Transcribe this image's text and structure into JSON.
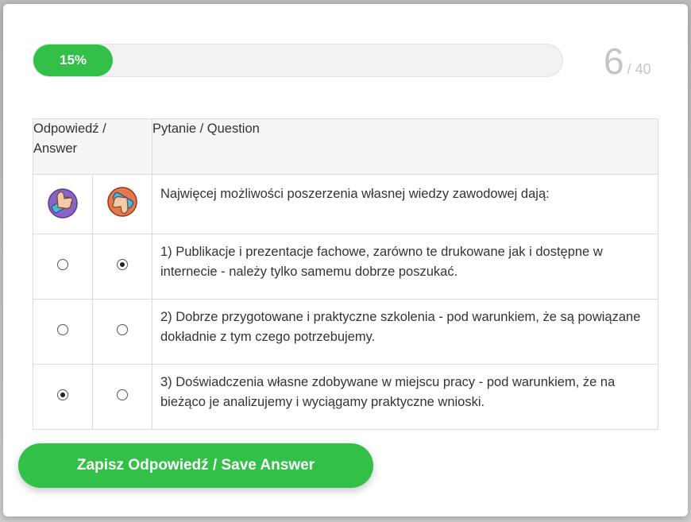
{
  "progress": {
    "percent": 15,
    "label": "15%"
  },
  "counter": {
    "current": "6",
    "total": "/ 40"
  },
  "table": {
    "header_answer": "Odpowiedź / Answer",
    "header_question": "Pytanie / Question",
    "icons": [
      "thumbs-up-icon",
      "thumbs-down-icon"
    ],
    "question": "Najwięcej możliwości poszerzenia własnej wiedzy zawodowej dają:",
    "answers": [
      {
        "text": "1) Publikacje i prezentacje fachowe, zarówno te drukowane jak i dostępne w internecie - należy tylko samemu dobrze poszukać.",
        "selected": "disagree"
      },
      {
        "text": "2) Dobrze przygotowane i praktyczne szkolenia - pod warunkiem, że są powiązane dokładnie z tym czego potrzebujemy.",
        "selected": "none"
      },
      {
        "text": "3) Doświadczenia własne zdobywane w miejscu pracy - pod warunkiem, że na bieżąco je analizujemy i wyciągamy praktyczne wnioski.",
        "selected": "agree"
      }
    ]
  },
  "save_button": {
    "label": "Zapisz Odpowiedź / Save Answer"
  },
  "colors": {
    "accent": "#33c049",
    "counter_text": "#c4c4c4"
  }
}
